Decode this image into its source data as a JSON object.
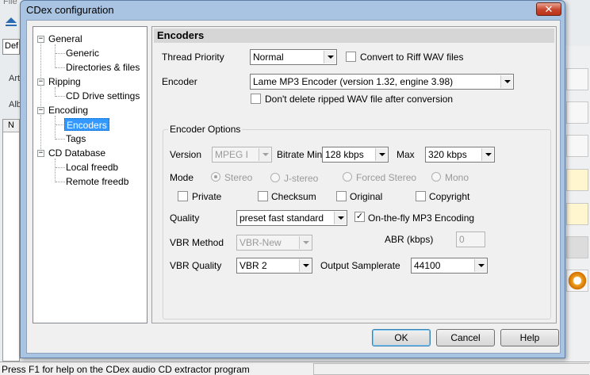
{
  "background": {
    "menu_file": "File",
    "combo_value": "Def",
    "label_artist": "Art",
    "label_album": "Alb",
    "list_header": "N",
    "status_text": "Press F1 for help on the CDex audio CD extractor program"
  },
  "dialog": {
    "title": "CDex configuration",
    "close_glyph": "✕",
    "buttons": {
      "ok": "OK",
      "cancel": "Cancel",
      "help": "Help"
    }
  },
  "tree": {
    "general": "General",
    "generic": "Generic",
    "directories": "Directories & files",
    "ripping": "Ripping",
    "cd_drive": "CD Drive settings",
    "encoding": "Encoding",
    "encoders": "Encoders",
    "tags": "Tags",
    "cd_database": "CD Database",
    "local_freedb": "Local freedb",
    "remote_freedb": "Remote freedb",
    "expanded_glyph": "−"
  },
  "page": {
    "header": "Encoders",
    "thread_priority_label": "Thread Priority",
    "thread_priority_value": "Normal",
    "convert_riff_label": "Convert to Riff WAV files",
    "convert_riff_checked": false,
    "encoder_label": "Encoder",
    "encoder_value": "Lame MP3 Encoder (version 1.32, engine 3.98)",
    "dont_delete_label": "Don't delete ripped WAV file after conversion",
    "dont_delete_checked": false,
    "encoder_options": {
      "group_title": "Encoder Options",
      "version_label": "Version",
      "version_value": "MPEG I",
      "bitrate_min_label": "Bitrate Min",
      "bitrate_min_value": "128 kbps",
      "max_label": "Max",
      "max_value": "320 kbps",
      "mode_label": "Mode",
      "modes": [
        "Stereo",
        "J-stereo",
        "Forced Stereo",
        "Mono"
      ],
      "mode_selected": "Stereo",
      "private_label": "Private",
      "checksum_label": "Checksum",
      "original_label": "Original",
      "copyright_label": "Copyright",
      "quality_label": "Quality",
      "quality_value": "preset fast standard",
      "on_the_fly_label": "On-the-fly MP3 Encoding",
      "on_the_fly_checked": true,
      "check_glyph": "✓",
      "vbr_method_label": "VBR Method",
      "vbr_method_value": "VBR-New",
      "abr_label": "ABR (kbps)",
      "abr_value": "0",
      "vbr_quality_label": "VBR Quality",
      "vbr_quality_value": "VBR 2",
      "output_samplerate_label": "Output Samplerate",
      "output_samplerate_value": "44100"
    }
  }
}
